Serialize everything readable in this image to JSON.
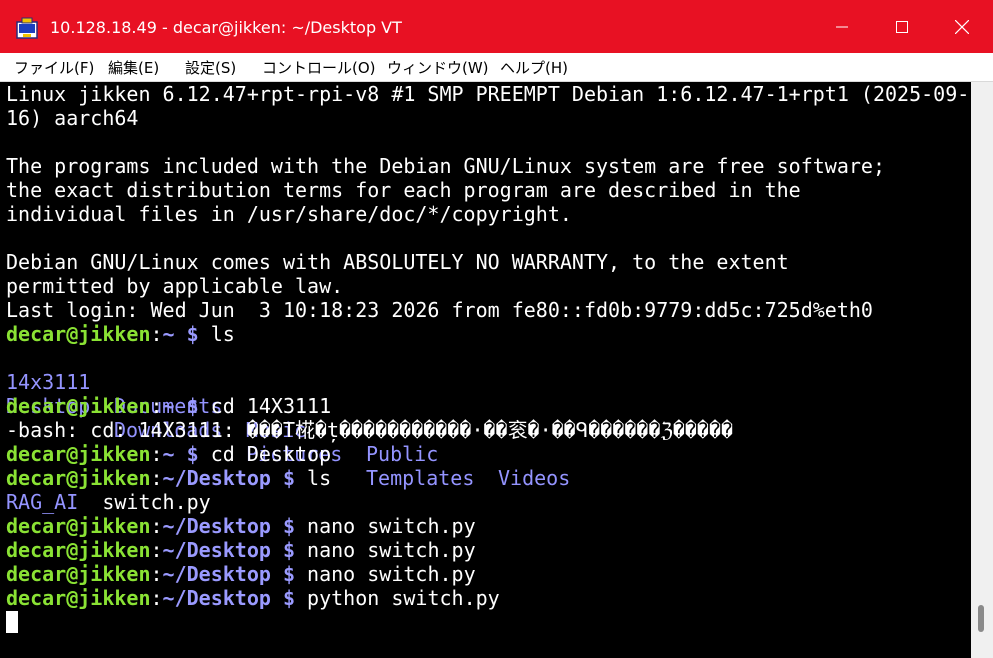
{
  "window": {
    "title": "10.128.18.49 - decar@jikken: ~/Desktop VT",
    "accent_color": "#e81123",
    "icons": [
      "app-icon",
      "minimize-icon",
      "maximize-icon",
      "close-icon"
    ]
  },
  "menubar": {
    "items": [
      {
        "label": "ファイル(F)"
      },
      {
        "label": "編集(E)"
      },
      {
        "label": "設定(S)"
      },
      {
        "label": "コントロール(O)"
      },
      {
        "label": "ウィンドウ(W)"
      },
      {
        "label": "ヘルプ(H)"
      }
    ]
  },
  "terminal": {
    "colors": {
      "background": "#000000",
      "foreground": "#ffffff",
      "prompt_user": "#8ae234",
      "prompt_path": "#9a9aff",
      "directory": "#9494ff"
    },
    "lines": [
      {
        "text": "Linux jikken 6.12.47+rpt-rpi-v8 #1 SMP PREEMPT Debian 1:6.12.47-1+rpt1 (2025-09-"
      },
      {
        "text": "16) aarch64"
      },
      {
        "text": ""
      },
      {
        "text": "The programs included with the Debian GNU/Linux system are free software;"
      },
      {
        "text": "the exact distribution terms for each program are described in the"
      },
      {
        "text": "individual files in /usr/share/doc/*/copyright."
      },
      {
        "text": ""
      },
      {
        "text": "Debian GNU/Linux comes with ABSOLUTELY NO WARRANTY, to the extent"
      },
      {
        "text": "permitted by applicable law."
      },
      {
        "text": "Last login: Wed Jun  3 10:18:23 2026 from fe80::fd0b:9779:dd5c:725d%eth0"
      },
      {
        "prompt_user": "decar@jikken",
        "prompt_path": "~",
        "prompt_symbol": " $",
        "command": " ls"
      },
      {
        "dirs": [
          "14x3111",
          "Documents",
          "Music",
          "Public",
          "Videos"
        ]
      },
      {
        "dirs": [
          "Desktop",
          "Downloads",
          "Pictures",
          "Templates"
        ]
      },
      {
        "prompt_user": "decar@jikken",
        "prompt_path": "~",
        "prompt_symbol": " $",
        "command": " cd 14X3111"
      },
      {
        "text": "-bash: cd: 14X3111: ���T椛�ț�����������·��衮�·��ᑫ������ℨ�����"
      },
      {
        "prompt_user": "decar@jikken",
        "prompt_path": "~",
        "prompt_symbol": " $",
        "command": " cd Desktop"
      },
      {
        "prompt_user": "decar@jikken",
        "prompt_path": "~/Desktop",
        "prompt_symbol": " $",
        "command": " ls"
      },
      {
        "dir": "RAG_AI",
        "file": "  switch.py"
      },
      {
        "prompt_user": "decar@jikken",
        "prompt_path": "~/Desktop",
        "prompt_symbol": " $",
        "command": " nano switch.py"
      },
      {
        "prompt_user": "decar@jikken",
        "prompt_path": "~/Desktop",
        "prompt_symbol": " $",
        "command": " nano switch.py"
      },
      {
        "prompt_user": "decar@jikken",
        "prompt_path": "~/Desktop",
        "prompt_symbol": " $",
        "command": " nano switch.py"
      },
      {
        "prompt_user": "decar@jikken",
        "prompt_path": "~/Desktop",
        "prompt_symbol": " $",
        "command": " python switch.py"
      }
    ],
    "prompt_separator": ":"
  }
}
